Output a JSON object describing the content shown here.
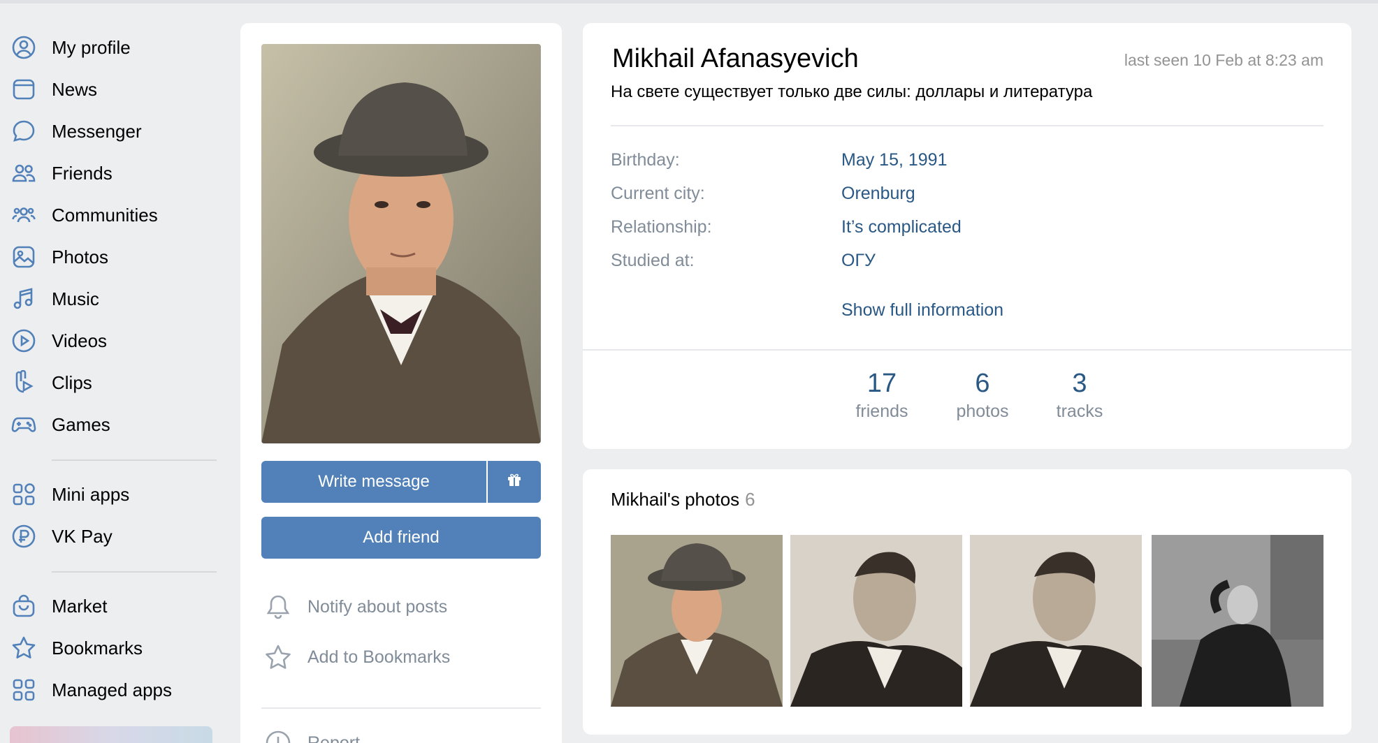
{
  "sidebar": {
    "items": [
      {
        "label": "My profile",
        "icon": "user-circle-icon"
      },
      {
        "label": "News",
        "icon": "news-icon"
      },
      {
        "label": "Messenger",
        "icon": "message-bubble-icon"
      },
      {
        "label": "Friends",
        "icon": "friends-icon"
      },
      {
        "label": "Communities",
        "icon": "communities-icon"
      },
      {
        "label": "Photos",
        "icon": "photo-icon"
      },
      {
        "label": "Music",
        "icon": "music-note-icon"
      },
      {
        "label": "Videos",
        "icon": "play-circle-icon"
      },
      {
        "label": "Clips",
        "icon": "clips-icon"
      },
      {
        "label": "Games",
        "icon": "gamepad-icon"
      }
    ],
    "items2": [
      {
        "label": "Mini apps",
        "icon": "mini-apps-icon"
      },
      {
        "label": "VK Pay",
        "icon": "ruble-circle-icon"
      }
    ],
    "items3": [
      {
        "label": "Market",
        "icon": "shopping-bag-icon"
      },
      {
        "label": "Bookmarks",
        "icon": "star-icon"
      },
      {
        "label": "Managed apps",
        "icon": "managed-apps-icon"
      }
    ]
  },
  "profile": {
    "write_message": "Write message",
    "add_friend": "Add friend",
    "notify": "Notify about posts",
    "add_bookmarks": "Add to Bookmarks",
    "report": "Report"
  },
  "info": {
    "name": "Mikhail Afanasyevich",
    "last_seen": "last seen 10 Feb at 8:23 am",
    "status": "На свете существует только две силы: доллары и литература",
    "fields": [
      {
        "label": "Birthday:",
        "value": "May 15, 1991"
      },
      {
        "label": "Current city:",
        "value": "Orenburg"
      },
      {
        "label": "Relationship:",
        "value": "It’s complicated"
      },
      {
        "label": "Studied at:",
        "value": "ОГУ"
      }
    ],
    "show_full": "Show full information",
    "counters": [
      {
        "num": "17",
        "label": "friends"
      },
      {
        "num": "6",
        "label": "photos"
      },
      {
        "num": "3",
        "label": "tracks"
      }
    ]
  },
  "photos": {
    "title": "Mikhail's photos",
    "count": "6"
  },
  "colors": {
    "accent": "#5181b8",
    "link": "#2a5885",
    "muted": "#818c99",
    "background": "#edeef0"
  }
}
